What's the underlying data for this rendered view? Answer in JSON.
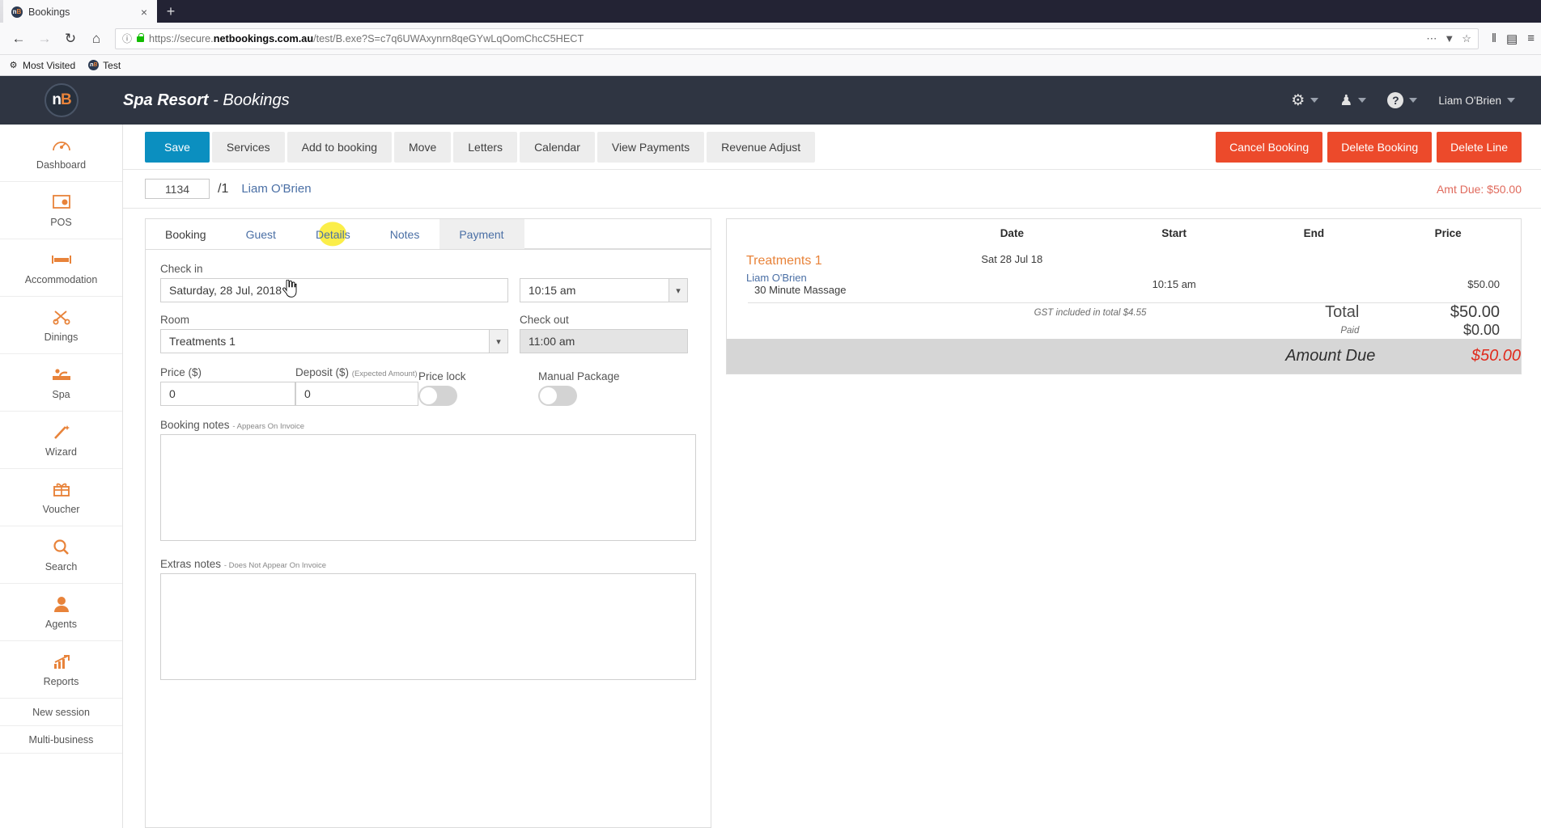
{
  "browser": {
    "tab": {
      "title": "Bookings",
      "favicon_text": "nB",
      "close_label": "×"
    },
    "newtab_label": "+",
    "nav": {
      "back": "←",
      "forward": "→",
      "reload": "↻",
      "home": "⌂"
    },
    "url": {
      "info_icon": "ⓘ",
      "prefix": "https://secure.",
      "domain": "netbookings.com.au",
      "path": "/test/B.exe?S=c7q6UWAxynrn8qeGYwLqOomChcC5HECT",
      "menu": "⋯",
      "pocket": "▼",
      "star": "☆"
    },
    "right_icons": {
      "library": "‖",
      "sidebar": "▤",
      "menu": "≡"
    },
    "bookmarks": [
      {
        "label": "Most Visited",
        "icon": "gear-icon"
      },
      {
        "label": "Test",
        "icon": "netbookings-favicon"
      }
    ]
  },
  "app": {
    "logo": {
      "n": "n",
      "b": "B"
    },
    "title_main": "Spa Resort",
    "title_sep": " - ",
    "title_sub": "Bookings",
    "header_icons": {
      "settings": "⚙",
      "agent": "♟",
      "help": "?"
    },
    "user_name": "Liam O'Brien"
  },
  "sidebar": {
    "items": [
      {
        "label": "Dashboard",
        "icon": "dashboard-icon",
        "glyph": "◔"
      },
      {
        "label": "POS",
        "icon": "pos-icon",
        "glyph": "▣"
      },
      {
        "label": "Accommodation",
        "icon": "bed-icon",
        "glyph": "Ὤf"
      },
      {
        "label": "Dinings",
        "icon": "cutlery-icon",
        "glyph": "⑀"
      },
      {
        "label": "Spa",
        "icon": "massage-icon",
        "glyph": "⚘"
      },
      {
        "label": "Wizard",
        "icon": "magic-wand-icon",
        "glyph": "✦"
      },
      {
        "label": "Voucher",
        "icon": "gift-icon",
        "glyph": "Ἰ1"
      },
      {
        "label": "Search",
        "icon": "search-icon",
        "glyph": "⚲"
      },
      {
        "label": "Agents",
        "icon": "agent-person-icon",
        "glyph": "☺"
      },
      {
        "label": "Reports",
        "icon": "chart-up-icon",
        "glyph": "⟋"
      }
    ],
    "plain_items": [
      {
        "label": "New session"
      },
      {
        "label": "Multi-business"
      }
    ]
  },
  "toolbar": {
    "buttons": [
      {
        "label": "Save",
        "style": "primary"
      },
      {
        "label": "Services",
        "style": "default"
      },
      {
        "label": "Add to booking",
        "style": "default"
      },
      {
        "label": "Move",
        "style": "default"
      },
      {
        "label": "Letters",
        "style": "default"
      },
      {
        "label": "Calendar",
        "style": "default"
      },
      {
        "label": "View Payments",
        "style": "default"
      },
      {
        "label": "Revenue Adjust",
        "style": "default"
      }
    ],
    "danger_buttons": [
      {
        "label": "Cancel Booking"
      },
      {
        "label": "Delete Booking"
      },
      {
        "label": "Delete Line"
      }
    ]
  },
  "reference": {
    "booking_number": "1134",
    "line_separator": "/1",
    "guest_name": "Liam O'Brien",
    "amount_due_label": "Amt Due: $50.00"
  },
  "tabs": [
    {
      "label": "Booking",
      "state": "active"
    },
    {
      "label": "Guest",
      "state": "normal"
    },
    {
      "label": "Details",
      "state": "hover"
    },
    {
      "label": "Notes",
      "state": "normal"
    },
    {
      "label": "Payment",
      "state": "grey"
    }
  ],
  "form": {
    "checkin_label": "Check in",
    "checkin_value": "Saturday, 28 Jul, 2018",
    "checkin_time_value": "10:15 am",
    "room_label": "Room",
    "room_value": "Treatments 1",
    "checkout_label": "Check out",
    "checkout_value": "11:00 am",
    "price_label": "Price ($)",
    "price_value": "0",
    "deposit_label": "Deposit ($)",
    "deposit_sub": "(Expected Amount)",
    "deposit_value": "0",
    "price_lock_label": "Price lock",
    "price_lock_state": "off",
    "manual_package_label": "Manual Package",
    "manual_package_state": "off",
    "booking_notes_label": "Booking notes",
    "booking_notes_sub": "- Appears On Invoice",
    "booking_notes_value": "",
    "extras_notes_label": "Extras notes",
    "extras_notes_sub": "- Does Not Appear On Invoice",
    "extras_notes_value": ""
  },
  "summary": {
    "columns": [
      "",
      "Date",
      "Start",
      "End",
      "Price"
    ],
    "group_name": "Treatments 1",
    "group_date": "Sat 28 Jul 18",
    "line": {
      "guest": "Liam O'Brien",
      "service": "30 Minute Massage",
      "start": "10:15 am",
      "end": "",
      "price": "$50.00"
    },
    "gst_note": "GST included in total $4.55",
    "total_label": "Total",
    "total_value": "$50.00",
    "paid_label": "Paid",
    "paid_value": "$0.00",
    "due_label": "Amount Due",
    "due_value": "$50.00"
  },
  "colors": {
    "accent_orange": "#e8833a",
    "primary_blue": "#0b8fc0",
    "danger_red": "#ec4a2b",
    "header_dark": "#2f3542",
    "due_red": "#e02b1d",
    "highlight_yellow": "#fbee49"
  }
}
